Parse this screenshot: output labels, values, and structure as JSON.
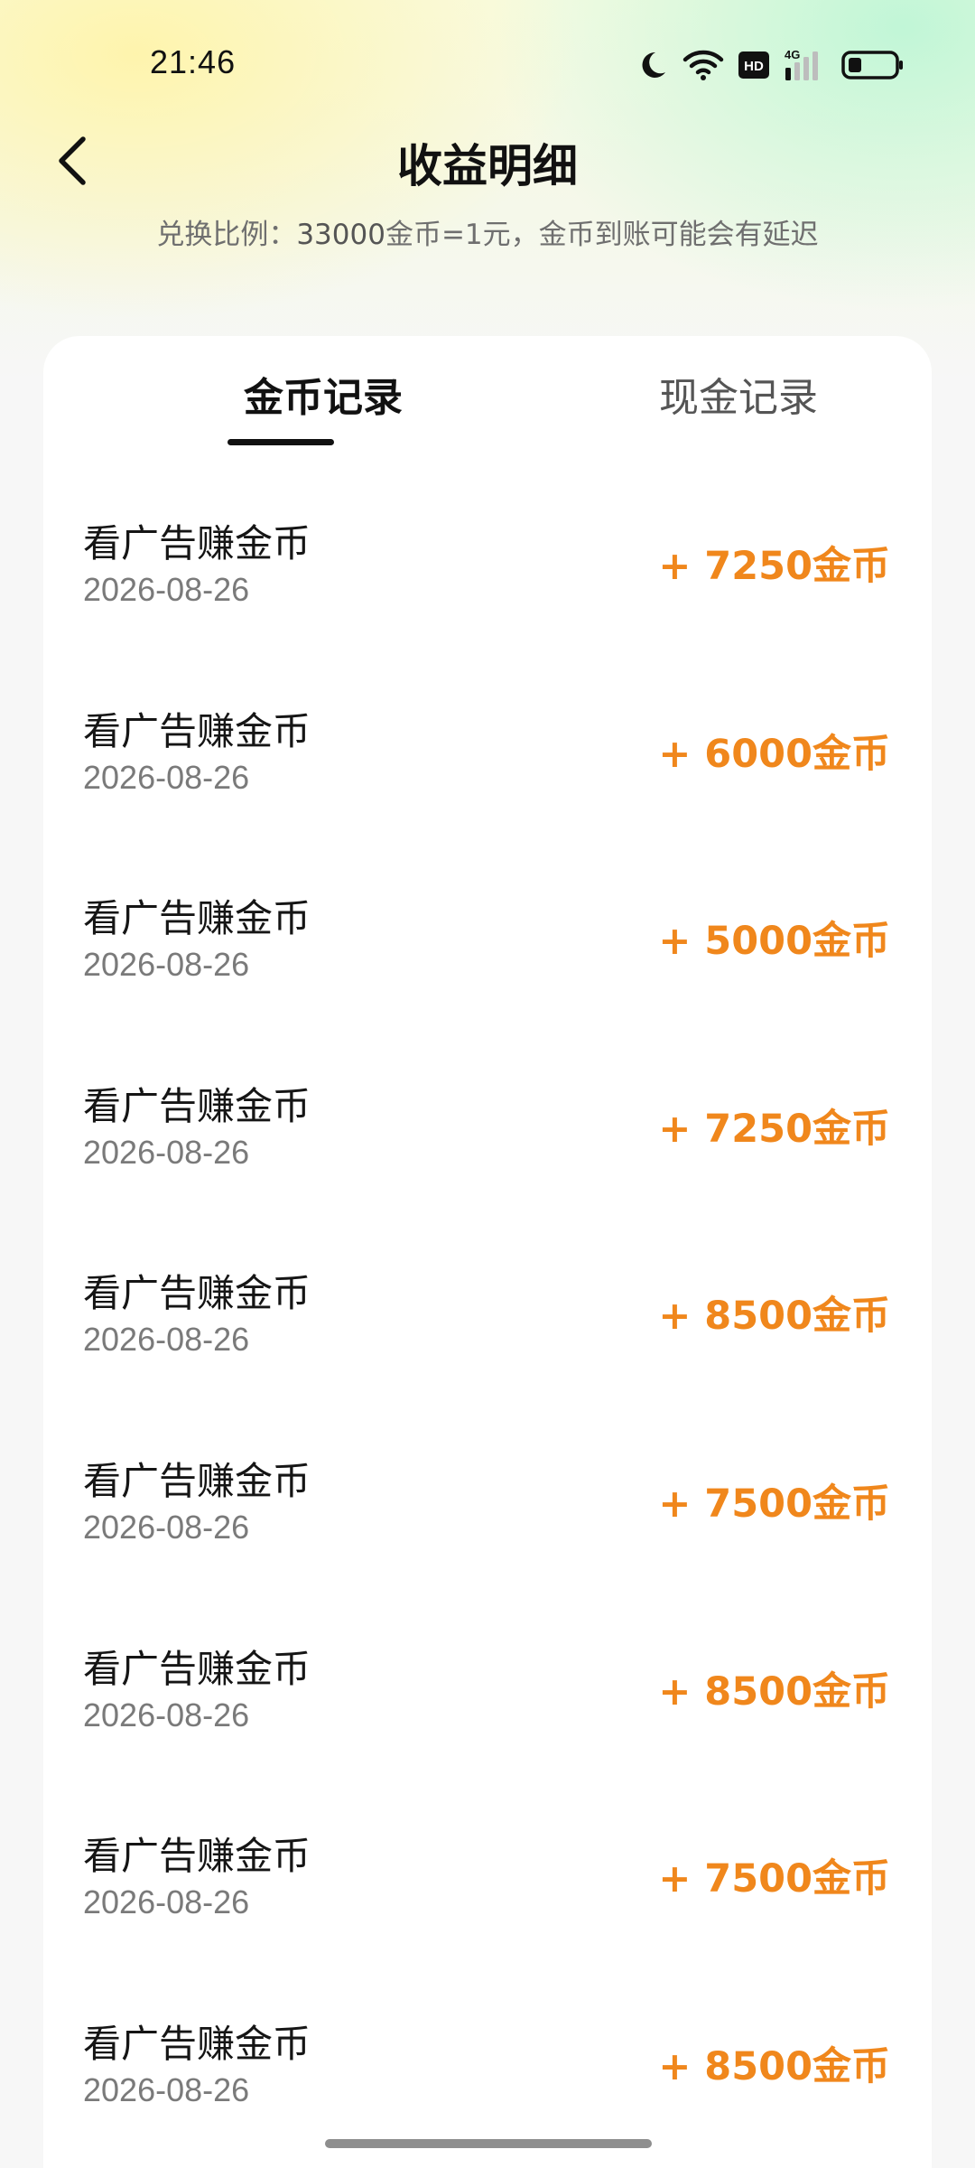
{
  "status_bar": {
    "time": "21:46",
    "icons": [
      "moon-icon",
      "wifi-icon",
      "hd-icon",
      "signal-4g-icon",
      "battery-icon"
    ],
    "hd_label": "HD",
    "network_label": "4G"
  },
  "header": {
    "title": "收益明细",
    "subtitle_prefix": "兑换比例：",
    "subtitle_number": "33000",
    "subtitle_suffix": "金币=1元，金币到账可能会有延迟"
  },
  "tabs": [
    {
      "label": "金币记录",
      "active": true
    },
    {
      "label": "现金记录",
      "active": false
    }
  ],
  "records": [
    {
      "title": "看广告赚金币",
      "date": "2026-08-26",
      "amount": "+ 7250金币"
    },
    {
      "title": "看广告赚金币",
      "date": "2026-08-26",
      "amount": "+ 6000金币"
    },
    {
      "title": "看广告赚金币",
      "date": "2026-08-26",
      "amount": "+ 5000金币"
    },
    {
      "title": "看广告赚金币",
      "date": "2026-08-26",
      "amount": "+ 7250金币"
    },
    {
      "title": "看广告赚金币",
      "date": "2026-08-26",
      "amount": "+ 8500金币"
    },
    {
      "title": "看广告赚金币",
      "date": "2026-08-26",
      "amount": "+ 7500金币"
    },
    {
      "title": "看广告赚金币",
      "date": "2026-08-26",
      "amount": "+ 8500金币"
    },
    {
      "title": "看广告赚金币",
      "date": "2026-08-26",
      "amount": "+ 7500金币"
    },
    {
      "title": "看广告赚金币",
      "date": "2026-08-26",
      "amount": "+ 8500金币"
    }
  ],
  "colors": {
    "amount": "#f0871c",
    "title": "#111111",
    "secondary": "#7a7a7a"
  }
}
